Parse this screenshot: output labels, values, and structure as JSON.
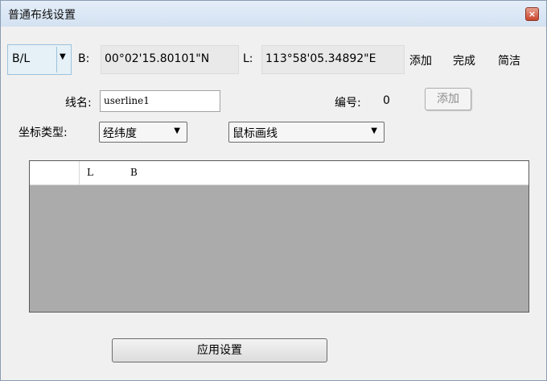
{
  "window": {
    "title": "普通布线设置",
    "close_glyph": "×"
  },
  "toolbar": {
    "coord_type": "B/L",
    "b_label": "B:",
    "b_value": "00°02'15.80101\"N",
    "l_label": "L:",
    "l_value": "113°58'05.34892\"E",
    "add_label": "添加",
    "finish_label": "完成",
    "simple_label": "简洁"
  },
  "form": {
    "line_name_label": "线名:",
    "line_name_value": "userline1",
    "number_label": "编号:",
    "number_value": "0",
    "add_button": "添加",
    "coord_type_label": "坐标类型:",
    "coord_type_value": "经纬度",
    "draw_mode_value": "鼠标画线"
  },
  "table": {
    "columns": [
      "L",
      "B"
    ],
    "rows": []
  },
  "apply_button": "应用设置"
}
